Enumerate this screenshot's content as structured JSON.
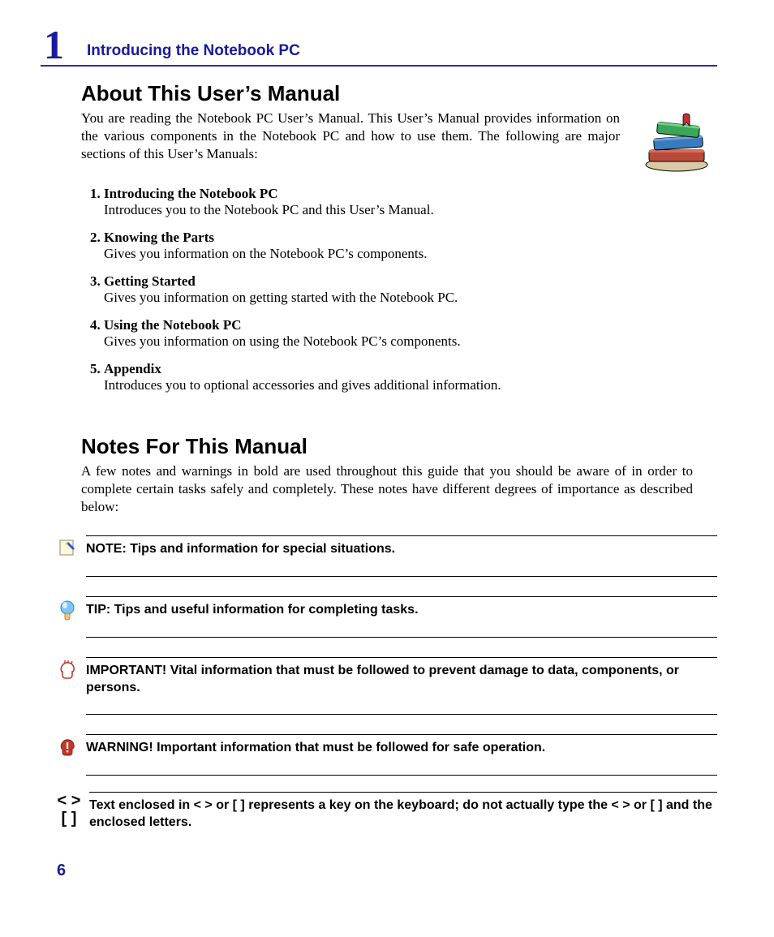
{
  "chapter": {
    "number": "1",
    "title": "Introducing the Notebook PC"
  },
  "about": {
    "heading": "About This User’s Manual",
    "intro": "You are reading the Notebook PC User’s Manual. This User’s Manual provides information on the various components in the Notebook PC and how to use them. The following are major sections of this User’s Manuals:",
    "items": [
      {
        "title": "Introducing the Notebook PC",
        "desc": "Introduces you to the Notebook PC and this User’s Manual."
      },
      {
        "title": "Knowing the Parts",
        "desc": "Gives you information on the Notebook PC’s components."
      },
      {
        "title": "Getting Started",
        "desc": "Gives you information on getting started with the Notebook PC."
      },
      {
        "title": "Using the Notebook PC",
        "desc": "Gives you information on using the Notebook PC’s components."
      },
      {
        "title": "Appendix",
        "desc": "Introduces you to optional accessories and gives additional information."
      }
    ]
  },
  "notes": {
    "heading": "Notes For This Manual",
    "intro": "A few notes and warnings in bold are used throughout this guide that you should be aware of in order to complete certain tasks safely and completely. These notes have different degrees of importance as described below:",
    "rows": [
      {
        "icon": "note-icon",
        "text": "NOTE: Tips and information for special situations."
      },
      {
        "icon": "tip-icon",
        "text": "TIP: Tips and useful information for completing tasks."
      },
      {
        "icon": "important-icon",
        "text": "IMPORTANT! Vital information that must be followed to prevent damage to data, components, or persons."
      },
      {
        "icon": "warning-icon",
        "text": "WARNING! Important information that must be followed for safe operation."
      },
      {
        "icon": "key-brackets-icon",
        "text": "Text enclosed in < > or [ ] represents a key on the keyboard; do not actually type the < > or [ ] and the enclosed letters."
      }
    ],
    "key_symbols": {
      "angle": "< >",
      "square": "[  ]"
    }
  },
  "page_number": "6"
}
